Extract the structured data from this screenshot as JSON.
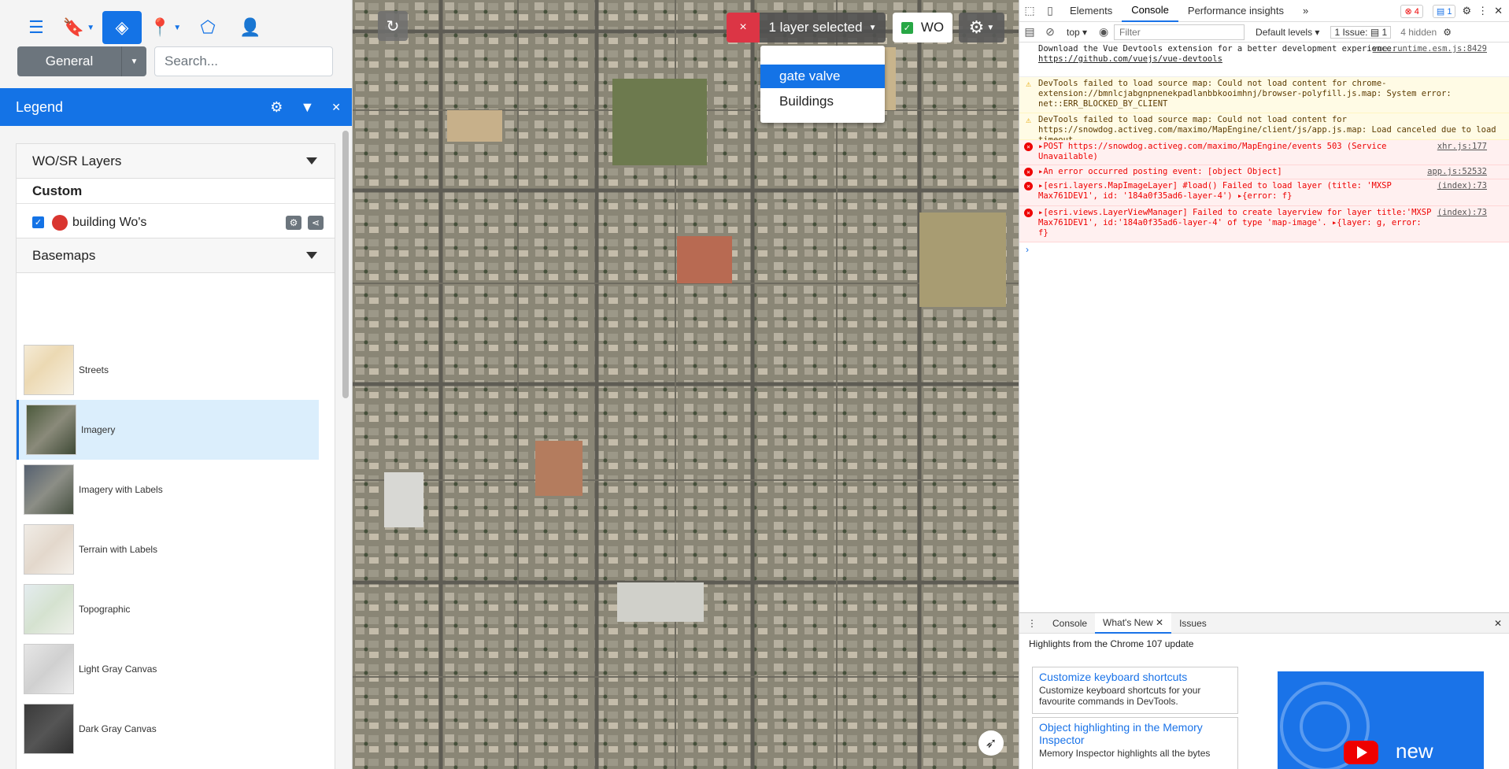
{
  "toolbar": {
    "list_icon": "list-icon",
    "bookmark_icon": "bookmark-icon",
    "layers_icon": "layers-icon",
    "location_icon": "location-pin-icon",
    "polygon_icon": "polygon-icon",
    "user_icon": "user-icon"
  },
  "general": {
    "label": "General"
  },
  "search": {
    "placeholder": "Search..."
  },
  "legend": {
    "title": "Legend"
  },
  "wosr": {
    "title": "WO/SR Layers",
    "custom_label": "Custom",
    "layer_name": "building Wo's",
    "add_label": "+"
  },
  "basemaps": {
    "title": "Basemaps",
    "items": [
      {
        "label": "Streets"
      },
      {
        "label": "Imagery"
      },
      {
        "label": "Imagery with Labels"
      },
      {
        "label": "Terrain with Labels"
      },
      {
        "label": "Topographic"
      },
      {
        "label": "Light Gray Canvas"
      },
      {
        "label": "Dark Gray Canvas"
      }
    ],
    "selected": "Imagery"
  },
  "map": {
    "close_label": "×",
    "layer_selector": "1 layer selected",
    "dropdown": [
      "gate valve",
      "Buildings"
    ],
    "wo_label": "WO",
    "compass_icon": "compass-icon"
  },
  "devtools": {
    "tabs": [
      "Elements",
      "Console",
      "Performance insights",
      "»"
    ],
    "active_tab": "Console",
    "error_count": "4",
    "message_count": "1",
    "context": "top",
    "filter_placeholder": "Filter",
    "levels": "Default levels",
    "issues": "1 Issue:",
    "issues_count": "1",
    "hidden": "4 hidden",
    "logs": [
      {
        "type": "info",
        "text": "Download the Vue Devtools extension for a better development experience:",
        "link": "https://github.com/vuejs/vue-devtools",
        "src": "vue.runtime.esm.js:8429"
      },
      {
        "type": "warn",
        "text": "DevTools failed to load source map: Could not load content for chrome-extension://bmnlcjabgnpnenekpadlanbbkooimhnj/browser-polyfill.js.map: System error: net::ERR_BLOCKED_BY_CLIENT",
        "src": ""
      },
      {
        "type": "warn",
        "text": "DevTools failed to load source map: Could not load content for https://snowdog.activeg.com/maximo/MapEngine/client/js/app.js.map: Load canceled due to load timeout",
        "src": ""
      },
      {
        "type": "err",
        "text": "▸POST https://snowdog.activeg.com/maximo/MapEngine/events 503 (Service Unavailable)",
        "src": "xhr.js:177"
      },
      {
        "type": "err",
        "text": "▸An error occurred posting event: [object Object]",
        "src": "app.js:52532"
      },
      {
        "type": "err",
        "text": "▸[esri.layers.MapImageLayer] #load() Failed to load layer (title: 'MXSP Max761DEV1', id: '184a0f35ad6-layer-4') ▸{error: f}",
        "src": "(index):73"
      },
      {
        "type": "err",
        "text": "▸[esri.views.LayerViewManager] Failed to create layerview for layer title:'MXSP Max761DEV1', id:'184a0f35ad6-layer-4' of type 'map-image'. ▸{layer: g, error: f}",
        "src": "(index):73"
      }
    ],
    "drawer_tabs": [
      "Console",
      "What's New",
      "Issues"
    ],
    "drawer_active": "What's New",
    "whats_new_heading": "Highlights from the Chrome 107 update",
    "cards": [
      {
        "title": "Customize keyboard shortcuts",
        "desc": "Customize keyboard shortcuts for your favourite commands in DevTools."
      },
      {
        "title": "Object highlighting in the Memory Inspector",
        "desc": "Memory Inspector highlights all the bytes"
      }
    ],
    "video_label": "new"
  },
  "colors": {
    "accent": "#1473e6",
    "danger": "#dc3545",
    "success": "#28a745"
  }
}
